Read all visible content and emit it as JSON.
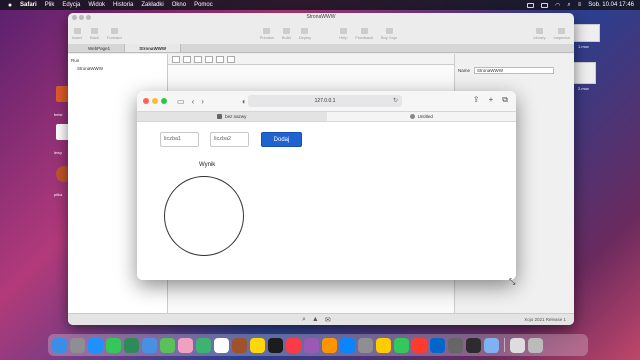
{
  "menubar": {
    "app": "Safari",
    "menus": [
      "Plik",
      "Edycja",
      "Widok",
      "Historia",
      "Zakładki",
      "Okno",
      "Pomoc"
    ],
    "clock": "Sob. 10.04  17:46"
  },
  "desktop": {
    "labels": [
      "beist",
      "lewy",
      "piłka"
    ],
    "thumb_labels": [
      "1.mov",
      "2.mov"
    ]
  },
  "xojo": {
    "title": "StronaWWW",
    "toolbar": [
      "Insert",
      "Back",
      "Forward",
      "Preview",
      "Build",
      "Deploy",
      "Help",
      "Feedback",
      "Buy Xojo",
      "Library",
      "Inspector"
    ],
    "tabs": [
      "WebPage1",
      "StronaWWW"
    ],
    "nav": [
      "Run",
      "StronaWWW"
    ],
    "inspector": {
      "name_label": "Name",
      "name_value": "StronaWWW"
    },
    "status": "Xojo 2021 Release 1"
  },
  "safari": {
    "url": "127.0.0.1",
    "tabs": [
      {
        "label": "bez nazwy",
        "active": false
      },
      {
        "label": "Untitled",
        "active": true
      }
    ],
    "page": {
      "input1_placeholder": "liczba1",
      "input2_placeholder": "liczba2",
      "add_button": "Dodaj",
      "result_label": "Wynik"
    }
  },
  "colors": {
    "accent": "#1f63d2",
    "close": "#ff5f57",
    "minimize": "#febc2e",
    "zoom": "#28c840"
  }
}
